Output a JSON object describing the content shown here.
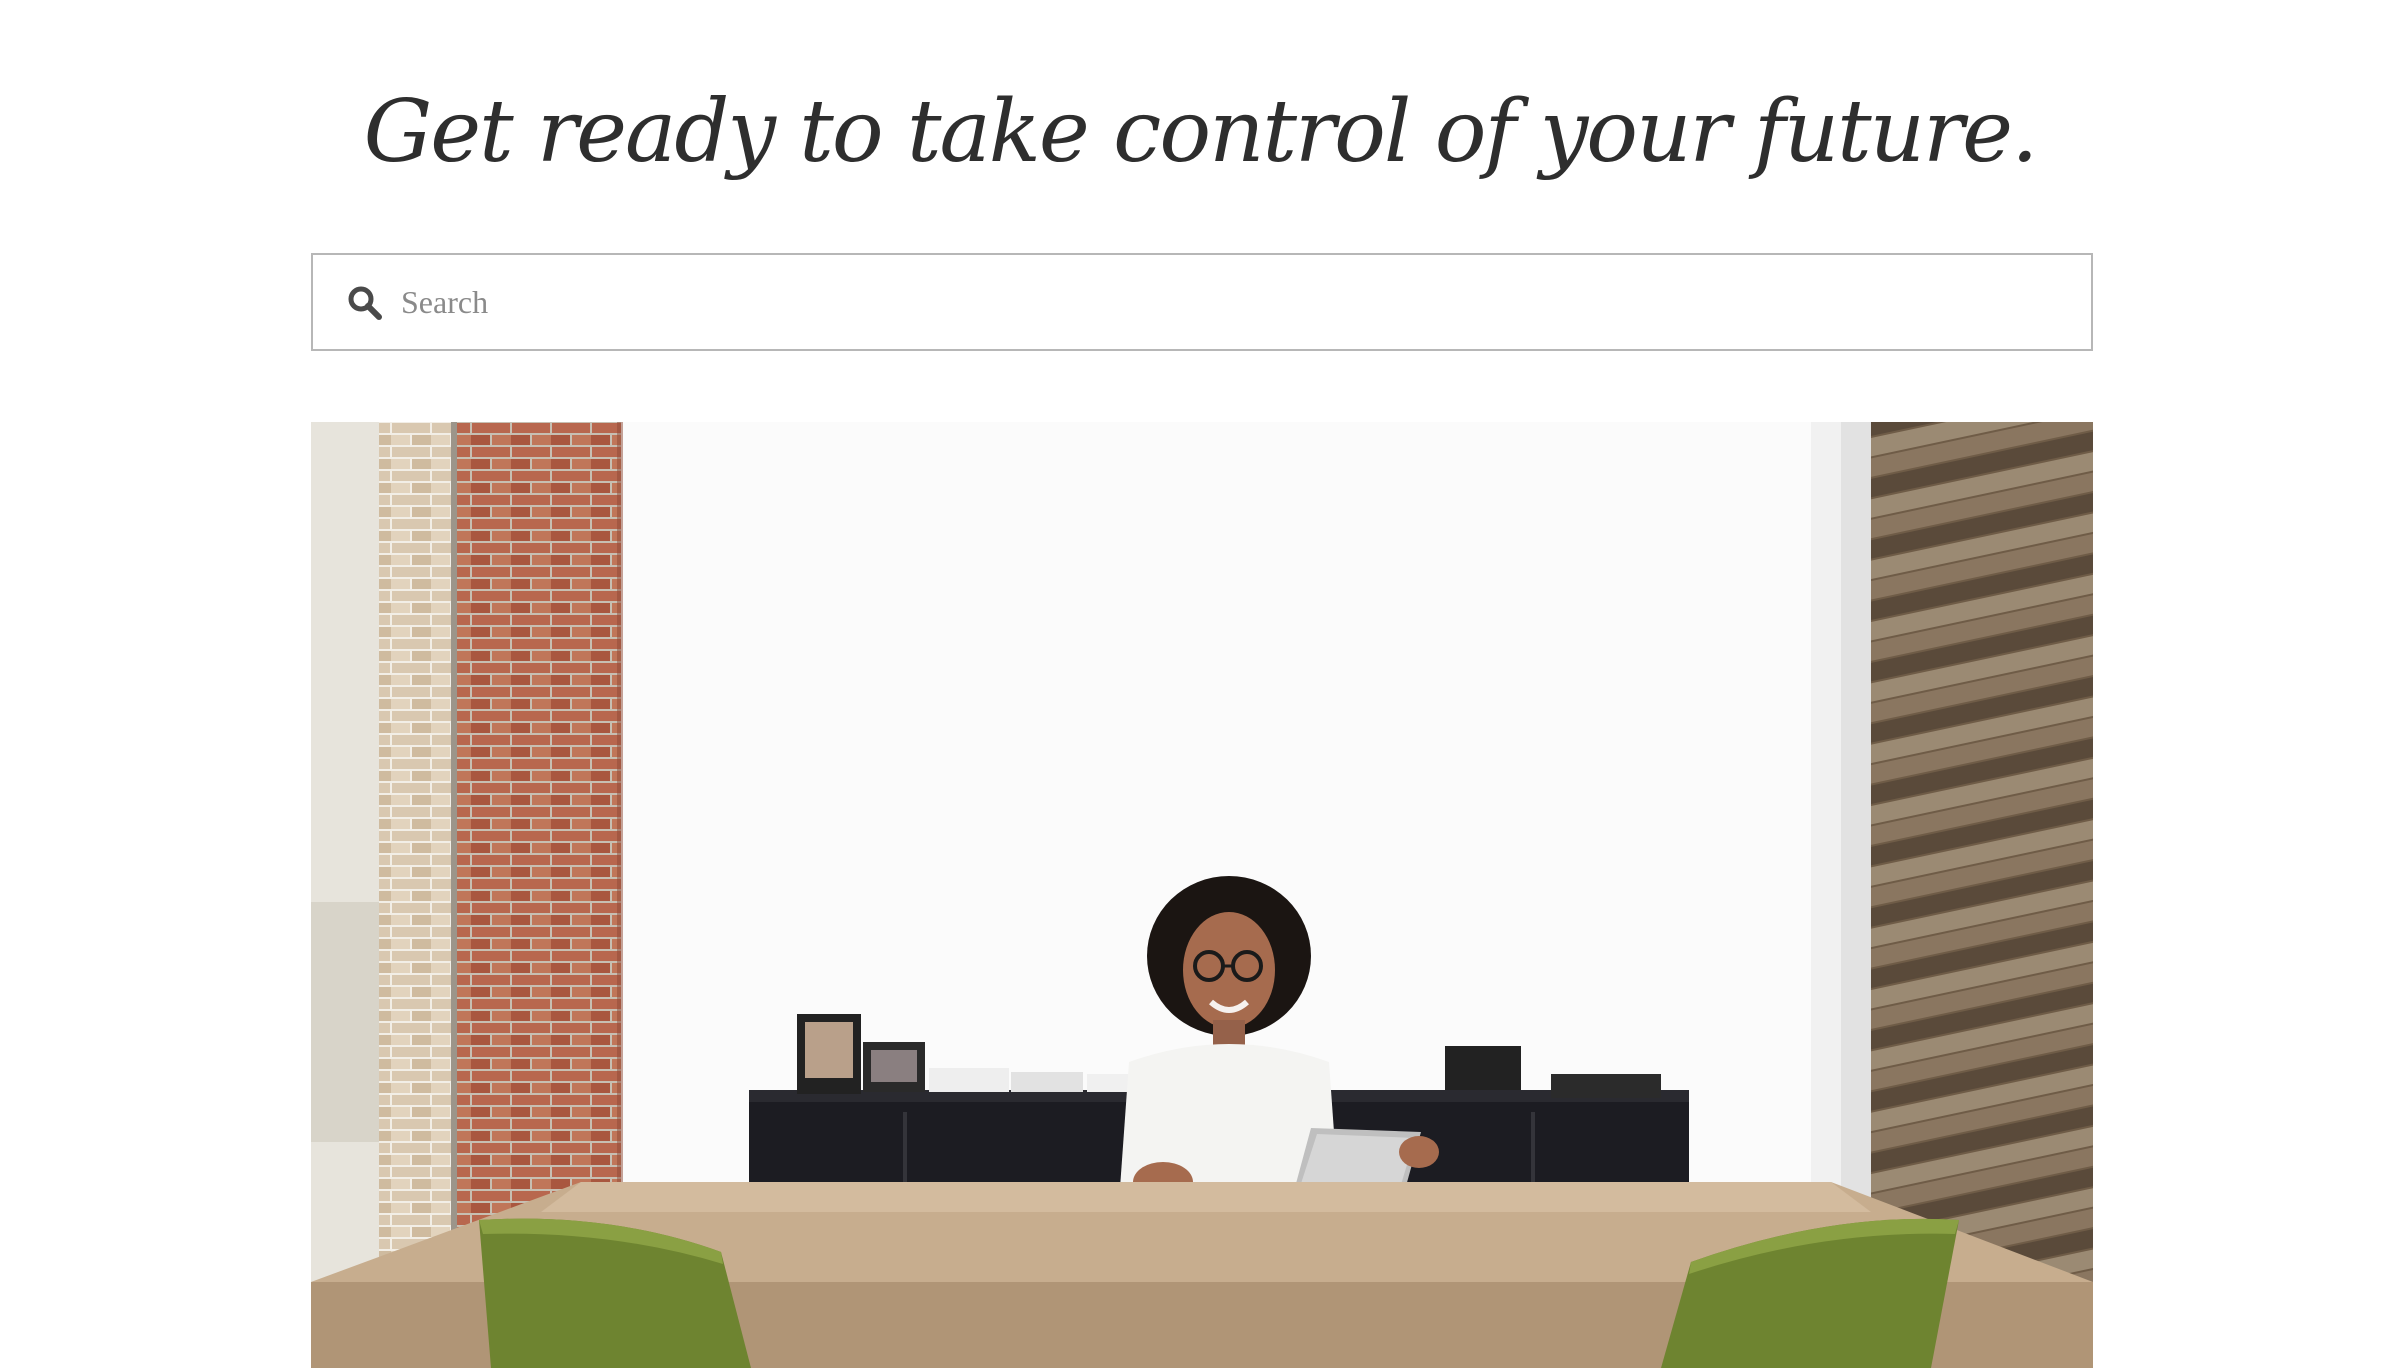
{
  "header": {
    "headline": "Get ready to take control of your future."
  },
  "search": {
    "placeholder": "Search",
    "value": "",
    "icon": "search-icon"
  },
  "hero_image": {
    "description_icon": "hero-photo",
    "colors": {
      "wall": "#fbfbfb",
      "brick": "#b8674e",
      "wood_panel": "#7a6650",
      "table": "#c7ad8e",
      "chair": "#6e8430",
      "credenza": "#1c1c22"
    }
  }
}
